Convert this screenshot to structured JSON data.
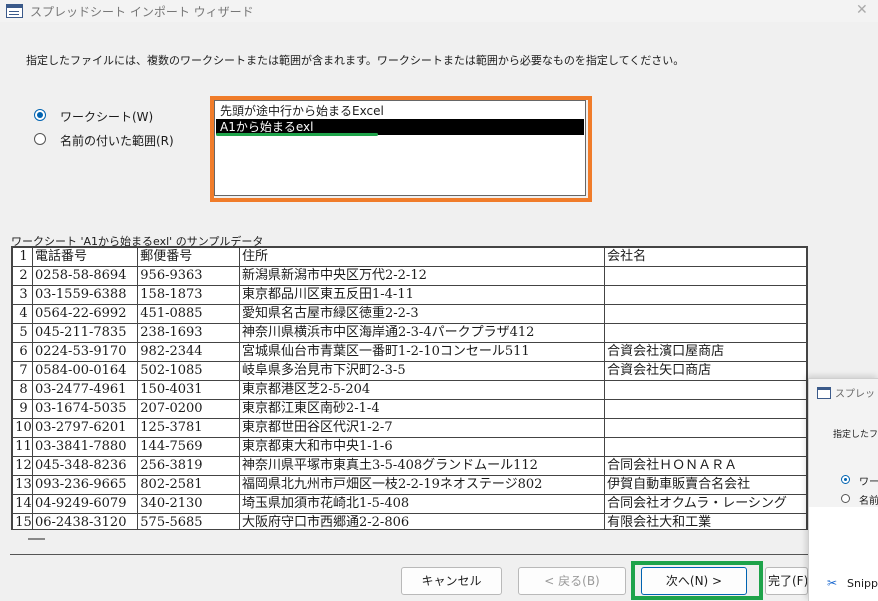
{
  "window": {
    "title": "スプレッドシート インポート ウィザード",
    "close_glyph": "✕"
  },
  "instructions": "指定したファイルには、複数のワークシートまたは範囲が含まれます。ワークシートまたは範囲から必要なものを指定してください。",
  "options": {
    "worksheet_label": "ワークシート(W)",
    "named_range_label": "名前の付いた範囲(R)",
    "selected": "worksheet"
  },
  "sheets": {
    "items": [
      "先頭が途中行から始まるExcel",
      "A1から始まるexl"
    ],
    "selected_index": 1
  },
  "sample": {
    "label": "ワークシート 'A1から始まるexl' のサンプルデータ",
    "rows": [
      [
        "1",
        "電話番号",
        "郵便番号",
        "住所",
        "会社名"
      ],
      [
        "2",
        "0258-58-8694",
        "956-9363",
        "新潟県新潟市中央区万代2-2-12",
        ""
      ],
      [
        "3",
        "03-1559-6388",
        "158-1873",
        "東京都品川区東五反田1-4-11",
        ""
      ],
      [
        "4",
        "0564-22-6992",
        "451-0885",
        "愛知県名古屋市緑区徳重2-2-3",
        ""
      ],
      [
        "5",
        "045-211-7835",
        "238-1693",
        "神奈川県横浜市中区海岸通2-3-4パークプラザ412",
        ""
      ],
      [
        "6",
        "0224-53-9170",
        "982-2344",
        "宮城県仙台市青葉区一番町1-2-10コンセール511",
        "合資会社濱口屋商店"
      ],
      [
        "7",
        "0584-00-0164",
        "502-1085",
        "岐阜県多治見市下沢町2-3-5",
        "合資会社矢口商店"
      ],
      [
        "8",
        "03-2477-4961",
        "150-4031",
        "東京都港区芝2-5-204",
        ""
      ],
      [
        "9",
        "03-1674-5035",
        "207-0200",
        "東京都江東区南砂2-1-4",
        ""
      ],
      [
        "10",
        "03-2797-6201",
        "125-3781",
        "東京都世田谷区代沢1-2-7",
        ""
      ],
      [
        "11",
        "03-3841-7880",
        "144-7569",
        "東京都東大和市中央1-1-6",
        ""
      ],
      [
        "12",
        "045-348-8236",
        "256-3819",
        "神奈川県平塚市東真土3-5-408グランドムール112",
        "合同会社ＨＯＮＡＲＡ"
      ],
      [
        "13",
        "093-236-9665",
        "802-2581",
        "福岡県北九州市戸畑区一枝2-2-19ネオステージ802",
        "伊賀自動車販賣合名会社"
      ],
      [
        "14",
        "04-9249-6079",
        "340-2130",
        "埼玉県加須市花崎北1-5-408",
        "合同会社オクムラ・レーシング"
      ],
      [
        "15",
        "06-2438-3120",
        "575-5685",
        "大阪府守口市西郷通2-2-806",
        "有限会社大和工業"
      ]
    ]
  },
  "buttons": {
    "cancel": "キャンセル",
    "back": "< 戻る(B)",
    "next": "次へ(N) >",
    "finish": "完了(F)"
  },
  "overlay_window": {
    "title": "スプレッドシート インポート ウィザード",
    "instructions": "指定したファイルには",
    "radio1": "ワークシート",
    "radio2": "名前の付いた範囲",
    "snip_label": "Snipping Tool"
  }
}
